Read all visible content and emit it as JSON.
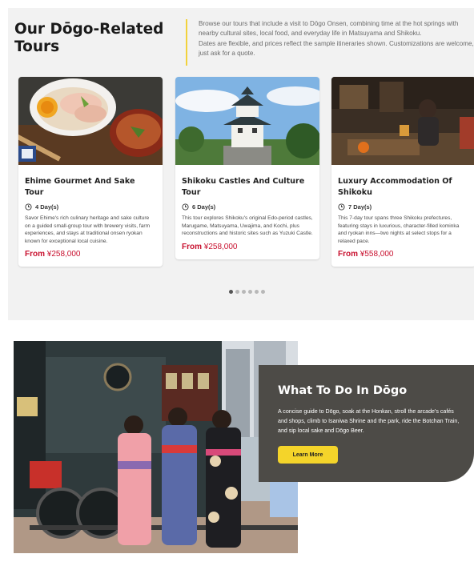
{
  "tours_section": {
    "title": "Our Dōgo-Related Tours",
    "intro_lines": [
      "Browse our tours that include a visit to Dōgo Onsen, combining time at the hot springs with",
      "nearby cultural sites, local food, and everyday life in Matsuyama and Shikoku.",
      "Dates are flexible, and prices reflect the sample itineraries shown. Customizations are welcome,",
      "just ask for a quote."
    ],
    "accent_color": "#f2d23c"
  },
  "cards": [
    {
      "image_icon": "food-photo",
      "title": "Ehime Gourmet And Sake Tour",
      "days": "4 Day(s)",
      "description": "Savor Ehime's rich culinary heritage and sake culture on a guided small-group tour with brewery visits, farm experiences, and stays at traditional onsen ryokan known for exceptional local cuisine.",
      "price_prefix": "From",
      "price": "¥258,000"
    },
    {
      "image_icon": "castle-photo",
      "title": "Shikoku Castles And Culture Tour",
      "days": "6 Day(s)",
      "description": "This tour explores Shikoku's original Edo-period castles, Marugame, Matsuyama, Uwajima, and Kochi, plus reconstructions and historic sites such as Yuzuki Castle.",
      "price_prefix": "From",
      "price": "¥258,000"
    },
    {
      "image_icon": "ryokan-photo",
      "title": "Luxury Accommodation Of Shikoku",
      "days": "7 Day(s)",
      "description": "This 7-day tour spans three Shikoku prefectures, featuring stays in luxurious, character-filled kominka and ryokan inns—two nights at select stops for a relaxed pace.",
      "price_prefix": "From",
      "price": "¥558,000"
    }
  ],
  "carousel": {
    "dot_count": 6,
    "active_index": 0
  },
  "feature": {
    "photo_icon": "botchan-train-kimono-photo",
    "title": "What To Do In Dōgo",
    "description": "A concise guide to Dōgo, soak at the Honkan, stroll the arcade's cafés and shops, climb to Isaniwa Shrine and the park, ride the Botchan Train, and sip local sake and Dōgo Beer.",
    "button_label": "Learn More",
    "button_color": "#f4d42a",
    "panel_color": "#4d4b47"
  },
  "price_color": "#c8102e"
}
